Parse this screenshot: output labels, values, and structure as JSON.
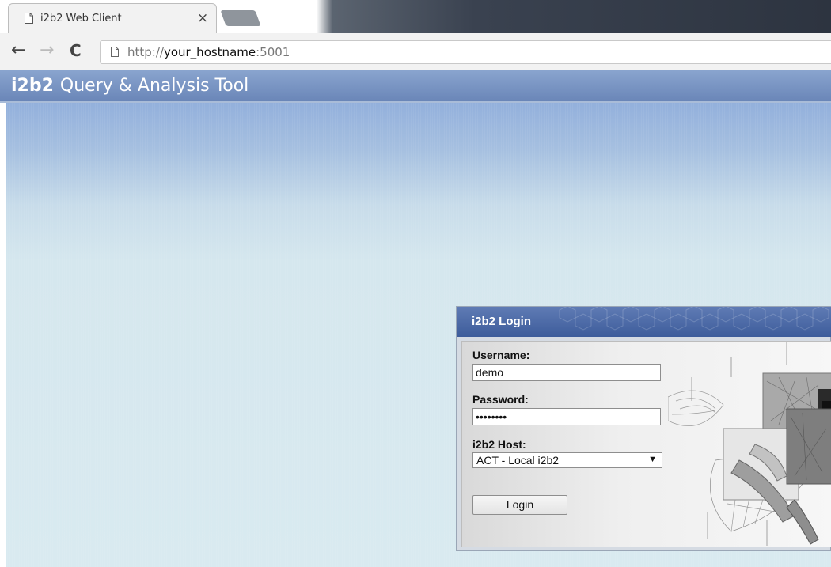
{
  "browser": {
    "tab_title": "i2b2 Web Client",
    "tab_close": "×",
    "url_scheme": "http://",
    "url_host": "your_hostname",
    "url_port": ":5001"
  },
  "app": {
    "brand": "i2b2",
    "title": "Query & Analysis Tool"
  },
  "login": {
    "title": "i2b2 Login",
    "username_label": "Username:",
    "username_value": "demo",
    "password_label": "Password:",
    "password_value": "demouser",
    "host_label": "i2b2 Host:",
    "host_selected": "ACT - Local i2b2",
    "login_button": "Login"
  },
  "colors": {
    "header_blue": "#6a86b8",
    "login_titlebar": "#3d5c9b",
    "page_background": "#d9eaf0"
  }
}
